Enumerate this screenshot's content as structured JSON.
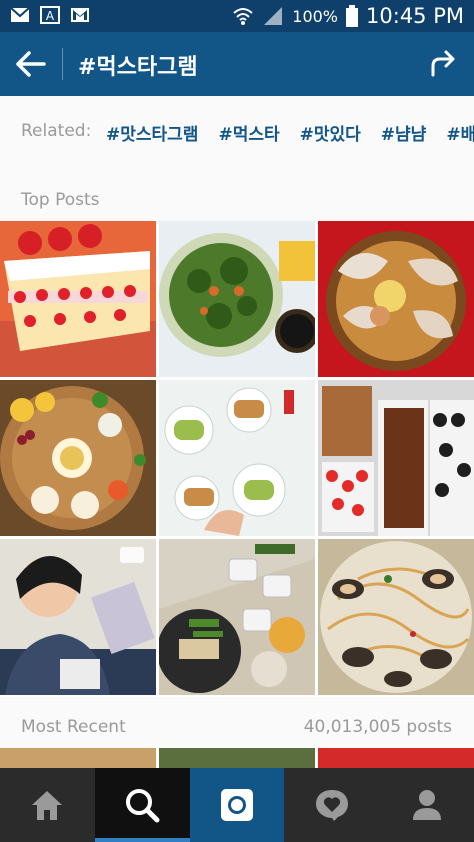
{
  "status_bar": {
    "battery": "100%",
    "time": "10:45 PM",
    "icons": [
      "mail-icon",
      "a-icon",
      "gmail-icon",
      "wifi-icon",
      "signal-icon",
      "battery-icon"
    ]
  },
  "app_bar": {
    "title": "#먹스타그램",
    "back_icon": "arrow-left-icon",
    "share_icon": "share-arrow-icon"
  },
  "related": {
    "label": "Related:",
    "tags": [
      "#맛스타그램",
      "#먹스타",
      "#맛있다",
      "#냠냠",
      "#배고"
    ]
  },
  "top_posts": {
    "label": "Top Posts",
    "tiles": [
      "strawberry-cake",
      "salad-bowl",
      "dumpling-soup",
      "fruit-platter",
      "tacos-table",
      "chocolate-dessert",
      "person-eating",
      "grill-table",
      "clam-pasta"
    ]
  },
  "most_recent": {
    "label": "Most Recent",
    "count": "40,013,005 posts"
  },
  "bottom_nav": {
    "items": [
      "home-icon",
      "search-icon",
      "camera-icon",
      "activity-icon",
      "profile-icon"
    ],
    "active": "search-icon"
  },
  "colors": {
    "status_bar": "#0f3f6b",
    "app_bar": "#125688",
    "tag_text": "#125688",
    "bottom_nav": "#2b2b2b"
  }
}
